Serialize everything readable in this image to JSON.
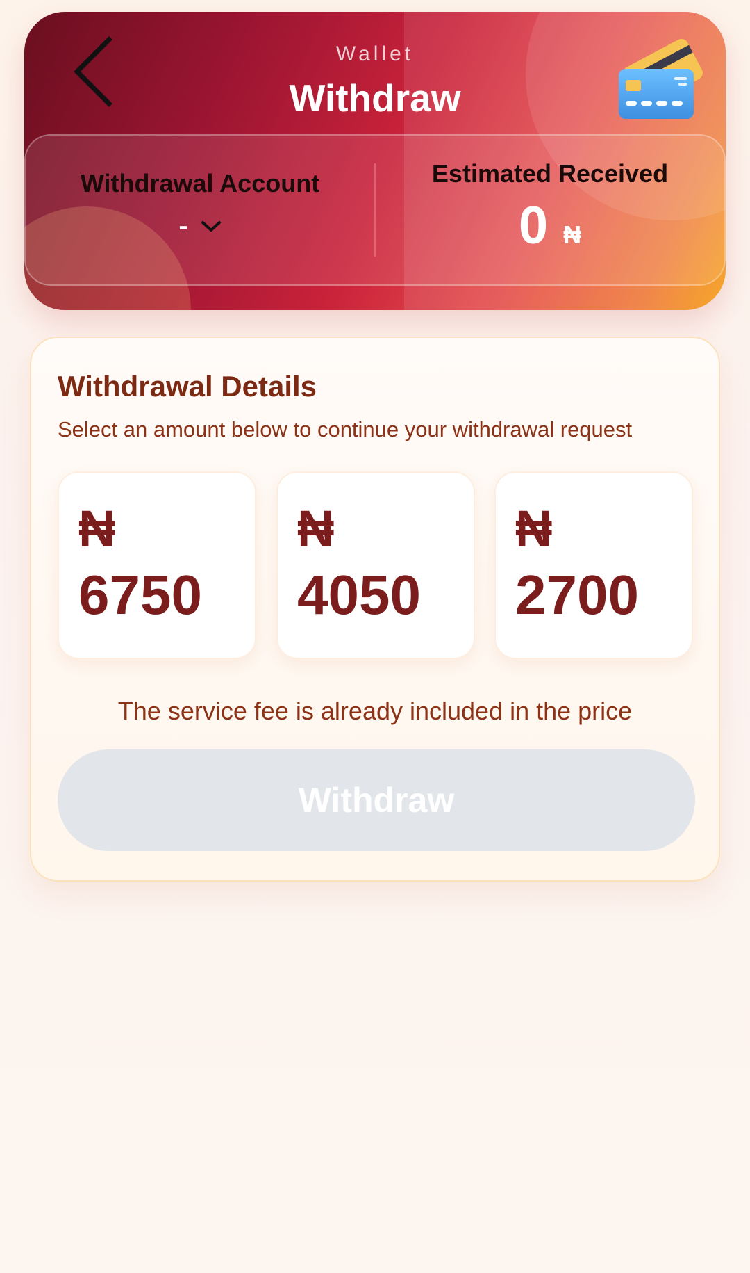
{
  "header": {
    "subtitle": "Wallet",
    "title": "Withdraw",
    "back_icon": "chevron-left-icon",
    "card_icon": "credit-card-icon"
  },
  "account": {
    "label": "Withdrawal Account",
    "value": "-",
    "dropdown_icon": "chevron-down-icon"
  },
  "received": {
    "label": "Estimated Received",
    "value": "0",
    "currency": "₦"
  },
  "details": {
    "title": "Withdrawal Details",
    "subtitle": "Select an amount below to continue your withdrawal request",
    "amounts": [
      {
        "currency": "₦",
        "value": "6750"
      },
      {
        "currency": "₦",
        "value": "4050"
      },
      {
        "currency": "₦",
        "value": "2700"
      }
    ],
    "fee_note": "The service fee is already included in the price",
    "withdraw_button": "Withdraw",
    "withdraw_enabled": false
  },
  "colors": {
    "accent_dark_red": "#7b1d1d",
    "text_brown": "#8c3216",
    "header_gradient_start": "#6a0f1f",
    "header_gradient_end": "#f59e10",
    "disabled_button": "#e2e5e9"
  }
}
